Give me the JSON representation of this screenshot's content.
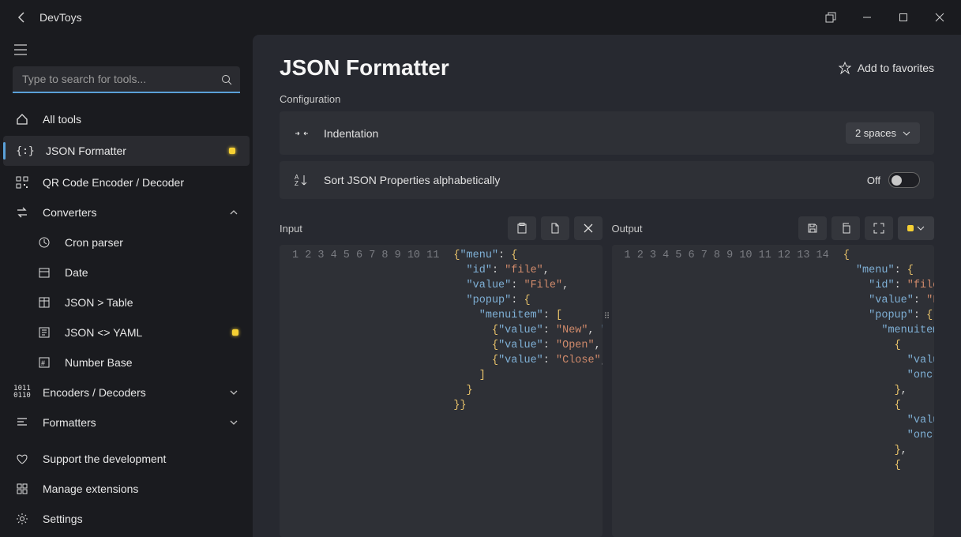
{
  "app": {
    "title": "DevToys"
  },
  "search": {
    "placeholder": "Type to search for tools..."
  },
  "nav": {
    "all_tools": "All tools",
    "json_formatter": "JSON Formatter",
    "qr": "QR Code Encoder / Decoder",
    "converters": "Converters",
    "cron": "Cron parser",
    "date": "Date",
    "json_table": "JSON > Table",
    "json_yaml": "JSON <> YAML",
    "number_base": "Number Base",
    "encoders": "Encoders / Decoders",
    "formatters": "Formatters"
  },
  "bottom": {
    "support": "Support the development",
    "extensions": "Manage extensions",
    "settings": "Settings"
  },
  "main": {
    "title": "JSON Formatter",
    "favorites": "Add to favorites",
    "config_label": "Configuration",
    "indent_label": "Indentation",
    "indent_value": "2 spaces",
    "sort_label": "Sort JSON Properties alphabetically",
    "sort_state": "Off",
    "input_label": "Input",
    "output_label": "Output"
  },
  "input_code": {
    "lines": [
      "1",
      "2",
      "3",
      "4",
      "5",
      "6",
      "7",
      "8",
      "9",
      "10",
      "11"
    ],
    "raw": "{\"menu\": {\n  \"id\": \"file\",\n  \"value\": \"File\",\n  \"popup\": {\n    \"menuitem\": [\n      {\"value\": \"New\", \"onclick\": \"CreateNewDoc()\"},\n      {\"value\": \"Open\", \"onclick\": \"OpenDoc()\"},\n      {\"value\": \"Close\", \"onclick\": \"CloseDoc()\"}\n    ]\n  }\n}}"
  },
  "output_code": {
    "lines": [
      "1",
      "2",
      "3",
      "4",
      "5",
      "6",
      "7",
      "8",
      "9",
      "10",
      "11",
      "12",
      "13",
      "14"
    ],
    "raw": "{\n  \"menu\": {\n    \"id\": \"file\",\n    \"value\": \"File\",\n    \"popup\": {\n      \"menuitem\": [\n        {\n          \"value\": \"New\",\n          \"onclick\": \"CreateNewDoc()\"\n        },\n        {\n          \"value\": \"Open\",\n          \"onclick\": \"OpenDoc()\"\n        },\n        {"
  }
}
